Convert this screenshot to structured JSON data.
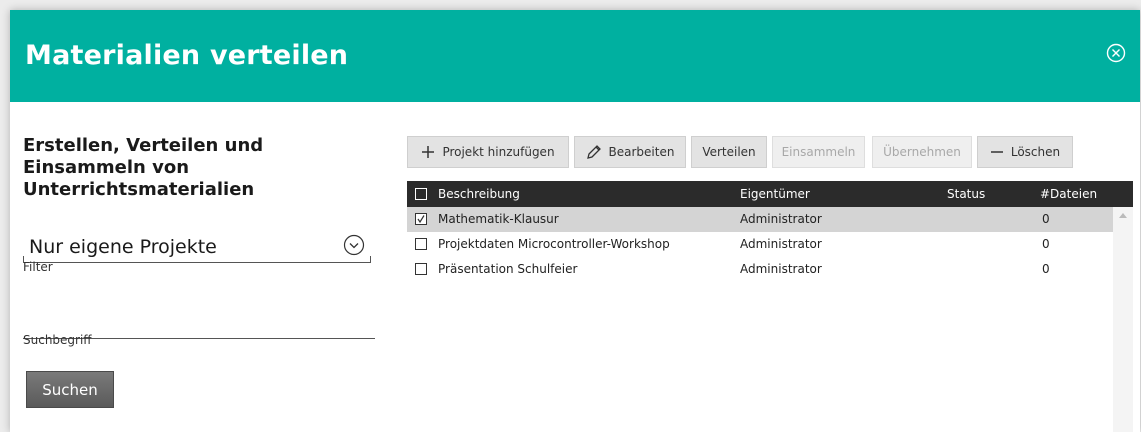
{
  "dialog": {
    "title": "Materialien verteilen",
    "close_icon": "close-circle-icon",
    "header_color": "#00b0a0"
  },
  "sidebar": {
    "heading": "Erstellen, Verteilen und Einsammeln von Unterrichtsmaterialien",
    "filter_value": "Nur eigene Projekte",
    "filter_label": "Filter",
    "search_value": "",
    "search_label": "Suchbegriff",
    "search_button": "Suchen"
  },
  "toolbar": {
    "add": "Projekt hinzufügen",
    "edit": "Bearbeiten",
    "distribute": "Verteilen",
    "collect": "Einsammeln",
    "adopt": "Übernehmen",
    "delete": "Löschen"
  },
  "table": {
    "columns": [
      "Beschreibung",
      "Eigentümer",
      "Status",
      "#Dateien"
    ],
    "rows": [
      {
        "description": "Mathematik-Klausur",
        "owner": "Administrator",
        "status": "",
        "files": "0",
        "selected": true
      },
      {
        "description": "Projektdaten Microcontroller-Workshop",
        "owner": "Administrator",
        "status": "",
        "files": "0",
        "selected": false
      },
      {
        "description": "Präsentation Schulfeier",
        "owner": "Administrator",
        "status": "",
        "files": "0",
        "selected": false
      }
    ]
  }
}
